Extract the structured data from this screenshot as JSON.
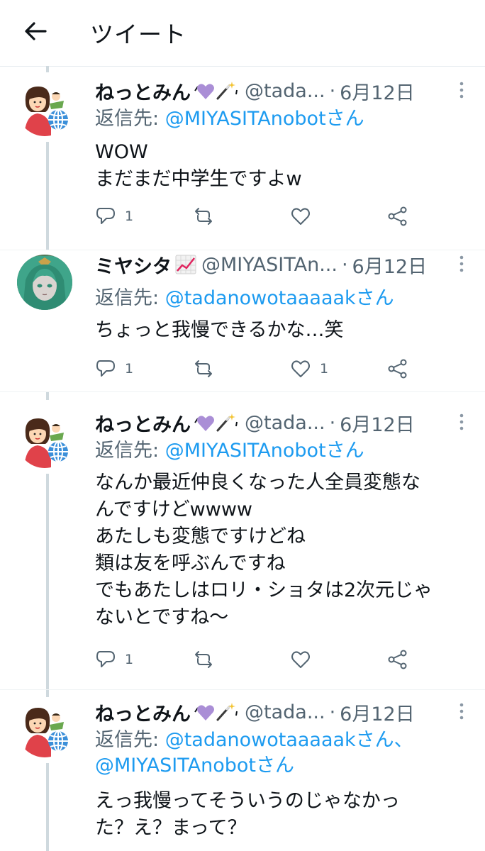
{
  "header": {
    "title": "ツイート",
    "back_icon": "arrow-left-icon"
  },
  "tweets": [
    {
      "display_name": "ねっとみん",
      "handle": "@tada...",
      "date": "6月12日",
      "reply_prefix": "返信先: ",
      "reply_mentions": "@MIYASITAnobotさん",
      "reply_mentions_2": "",
      "lines": [
        "WOW",
        "まだまだ中学生ですよw"
      ],
      "reply_count": "1",
      "retweet_count": "",
      "like_count": ""
    },
    {
      "display_name": "ミヤシタ",
      "handle": "@MIYASITAn...",
      "date": "6月12日",
      "reply_prefix": "返信先: ",
      "reply_mentions": "@tadanowotaaaaakさん",
      "reply_mentions_2": "",
      "lines": [
        "ちょっと我慢できるかな…笑"
      ],
      "reply_count": "1",
      "retweet_count": "",
      "like_count": "1"
    },
    {
      "display_name": "ねっとみん",
      "handle": "@tada...",
      "date": "6月12日",
      "reply_prefix": "返信先: ",
      "reply_mentions": "@MIYASITAnobotさん",
      "reply_mentions_2": "",
      "lines": [
        "なんか最近仲良くなった人全員変態な",
        "んですけどwwww",
        "あたしも変態ですけどね",
        "類は友を呼ぶんですね",
        "でもあたしはロリ・ショタは2次元じゃ",
        "ないとですね〜"
      ],
      "reply_count": "1",
      "retweet_count": "",
      "like_count": ""
    },
    {
      "display_name": "ねっとみん",
      "handle": "@tada...",
      "date": "6月12日",
      "reply_prefix": "返信先: ",
      "reply_mentions": "@tadanowotaaaaakさん、",
      "reply_mentions_2": "@MIYASITAnobotさん",
      "lines": [
        "えっ我慢ってそういうのじゃなかっ",
        "た？え？まって？"
      ],
      "reply_count": "",
      "retweet_count": "",
      "like_count": ""
    }
  ],
  "colors": {
    "link": "#1d9bf0",
    "secondary": "#536471",
    "thread_line": "#cfd9de"
  }
}
